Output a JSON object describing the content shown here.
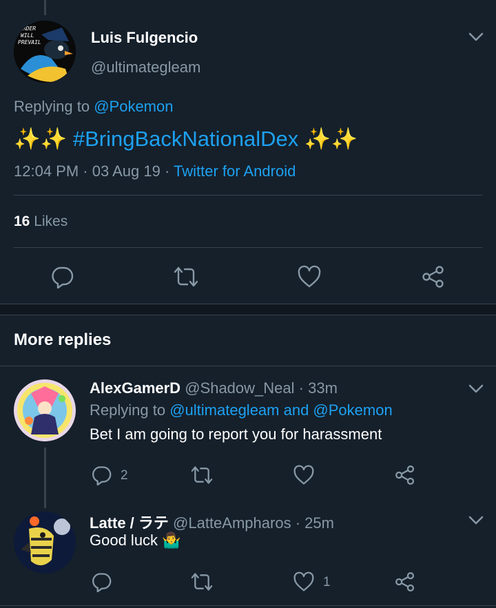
{
  "main_tweet": {
    "author_name": "Luis Fulgencio",
    "author_handle": "@ultimategleam",
    "replying_prefix": "Replying to",
    "replying_to": "@Pokemon",
    "text_sparkles_left": "✨✨",
    "hashtag": "#BringBackNationalDex",
    "text_sparkles_right": "✨✨",
    "time": "12:04 PM",
    "sep1": "·",
    "date": "03 Aug 19",
    "sep2": "·",
    "source": "Twitter for Android",
    "likes_count": "16",
    "likes_label": "Likes",
    "avatar_text": "ORDER WILL PREVAIL"
  },
  "section": {
    "more_replies": "More replies"
  },
  "replies": [
    {
      "author_name": "AlexGamerD",
      "author_handle": "@Shadow_Neal",
      "time": "· 33m",
      "replying_prefix": "Replying to",
      "replying_to": "@ultimategleam and @Pokemon",
      "text": "Bet I am going to report you for harassment",
      "reply_count": "2",
      "like_count": ""
    },
    {
      "author_name": "Latte / ラテ",
      "author_handle": "@LatteAmpharos",
      "time": "· 25m",
      "text": "Good luck",
      "emoji": "🤷‍♂️",
      "reply_count": "",
      "like_count": "1"
    }
  ],
  "colors": {
    "background": "#15202b",
    "section_background": "#10171e",
    "accent": "#1da1f2",
    "muted": "#8899a6",
    "divider": "#38444d"
  },
  "icons": [
    "chevron-down-icon",
    "reply-icon",
    "retweet-icon",
    "like-icon",
    "share-icon"
  ]
}
